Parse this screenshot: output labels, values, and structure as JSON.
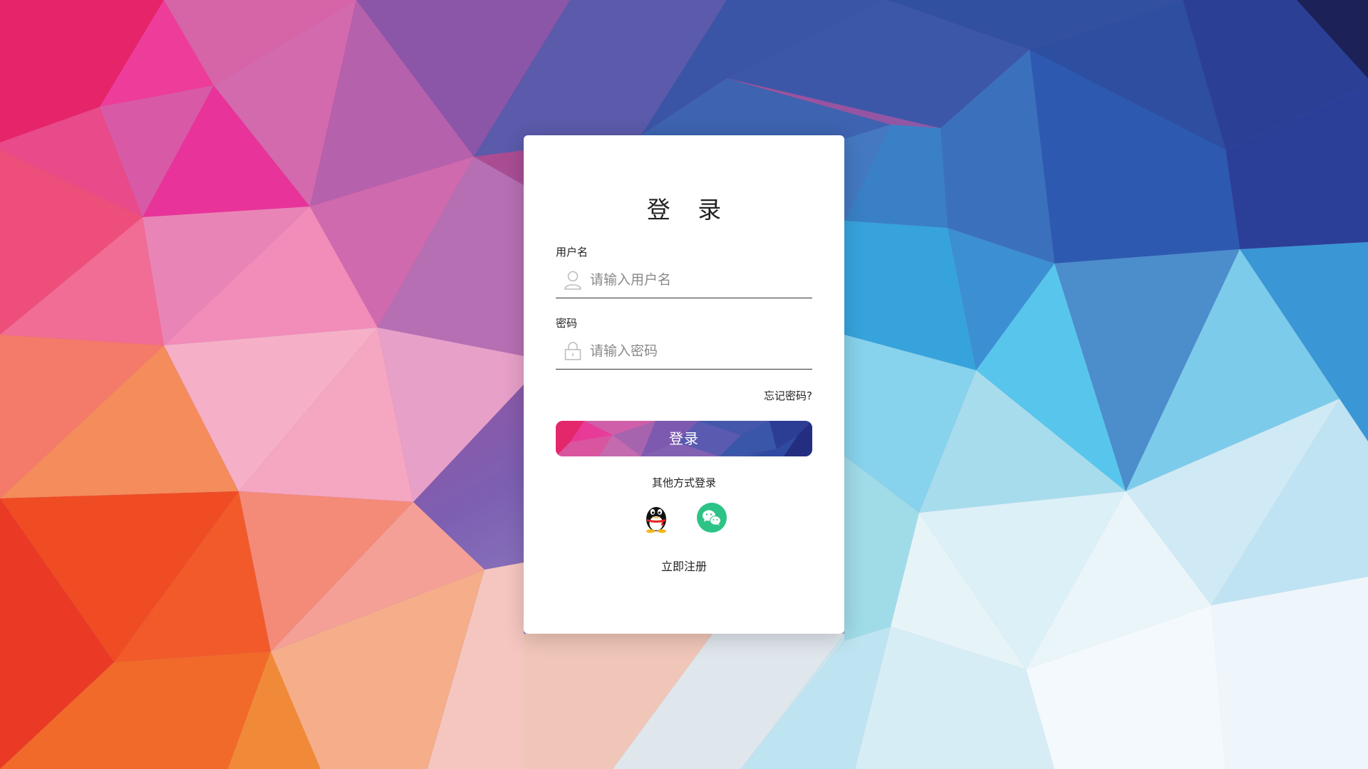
{
  "login": {
    "title": "登 录",
    "username": {
      "label": "用户名",
      "placeholder": "请输入用户名",
      "value": "",
      "icon": "user-icon"
    },
    "password": {
      "label": "密码",
      "placeholder": "请输入密码",
      "value": "",
      "icon": "lock-icon"
    },
    "forgot_label": "忘记密码?",
    "submit_label": "登录",
    "other_methods_label": "其他方式登录",
    "social": [
      {
        "icon": "qq-icon"
      },
      {
        "icon": "wechat-icon",
        "color": "#2dc386"
      }
    ],
    "register_label": "立即注册"
  },
  "colors": {
    "card": "#ffffff",
    "button_start": "#e8256e",
    "button_end": "#26338c",
    "wechat": "#2dc386"
  }
}
